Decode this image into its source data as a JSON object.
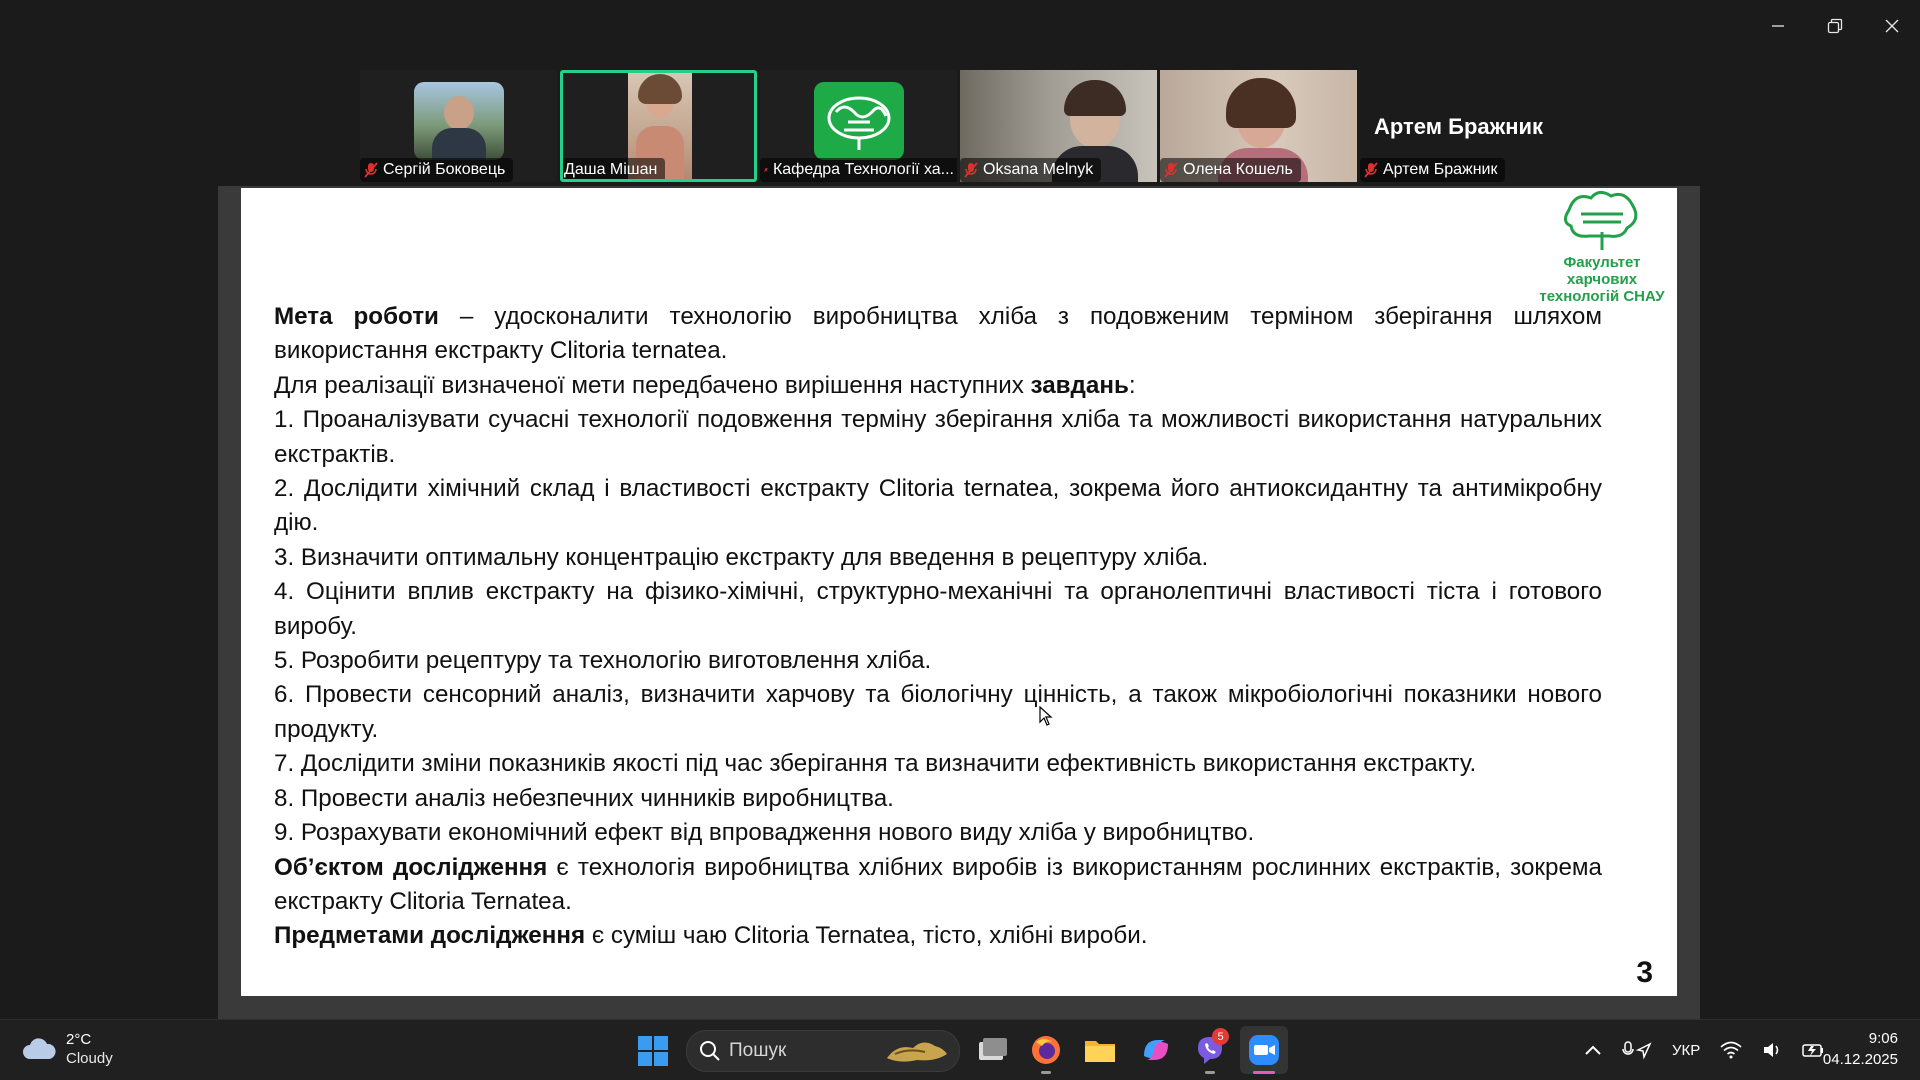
{
  "window": {
    "controls": [
      "minimize-icon",
      "restore-icon",
      "close-icon"
    ]
  },
  "participants": [
    {
      "name": "Сергій Боковець",
      "muted": true,
      "active": false
    },
    {
      "name": "Даша Мішан",
      "muted": false,
      "active": true
    },
    {
      "name": "Кафедра Технології ха...",
      "muted": true,
      "active": false
    },
    {
      "name": "Oksana Melnyk",
      "muted": true,
      "active": false
    },
    {
      "name": "Олена Кошель",
      "muted": true,
      "active": false
    },
    {
      "name": "Артем Бражник",
      "muted": true,
      "active": false
    }
  ],
  "speaker_name": "Артем Бражник",
  "slide": {
    "logo_text": "Факультет харчових технологій СНАУ",
    "page_number": "3",
    "aim_label": "Мета роботи",
    "aim_text": " – удосконалити технологію виробництва хліба з подовженим терміном зберігання шляхом використання екстракту Clitoria ternatea.",
    "tasks_intro": "Для реалізації визначеної мети передбачено вирішення наступних ",
    "tasks_word": "завдань",
    "tasks_colon": ":",
    "tasks": [
      "1. Проаналізувати сучасні технології подовження терміну зберігання хліба та можливості використання натуральних екстрактів.",
      "2. Дослідити хімічний склад і властивості екстракту Clitoria ternatea, зокрема його антиоксидантну та антимікробну дію.",
      "3. Визначити оптимальну концентрацію екстракту для введення в рецептуру хліба.",
      "4. Оцінити вплив екстракту на фізико-хімічні, структурно-механічні та органолептичні властивості тіста і готового виробу.",
      "5. Розробити рецептуру та технологію виготовлення хліба.",
      "6. Провести сенсорний аналіз, визначити харчову та біологічну цінність, а також мікробіологічні показники нового продукту.",
      "7. Дослідити зміни показників якості під час зберігання та визначити ефективність використання екстракту.",
      "8. Провести аналіз небезпечних чинників виробництва.",
      "9. Розрахувати економічний ефект від впровадження нового виду хліба у виробництво."
    ],
    "object_label": "Об’єктом дослідження",
    "object_text": " є технологія виробництва хлібних виробів із використанням рослинних екстрактів, зокрема екстракту Clitoria Ternatea.",
    "subject_label": "Предметами дослідження",
    "subject_text": " є суміш чаю Clitoria Ternatea, тісто, хлібні вироби."
  },
  "taskbar": {
    "weather_temp": "2°C",
    "weather_condition": "Cloudy",
    "search_placeholder": "Пошук",
    "pinned_apps": [
      "task-view-icon",
      "firefox-icon",
      "file-explorer-icon",
      "copilot-icon",
      "viber-icon",
      "zoom-icon"
    ],
    "viber_badge": "5",
    "language": "УКР",
    "time": "9:06",
    "date": "04.12.2025"
  }
}
